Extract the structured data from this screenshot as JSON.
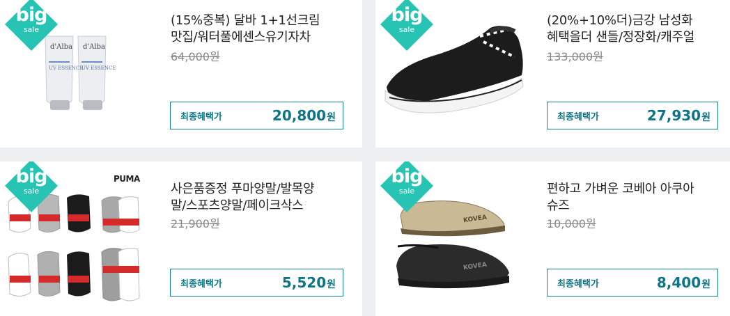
{
  "products": [
    {
      "badge": {
        "big": "big",
        "sale": "sale"
      },
      "title_line1": "(15%중복) 달바 1+1선크림",
      "title_line2": "맛집/워터풀에센스유기자차",
      "original_price": "64,000원",
      "final_label": "최종혜택가",
      "final_price": "20,800",
      "won": "원",
      "image_text": [
        "d'Alba",
        "d'Alba"
      ]
    },
    {
      "badge": {
        "big": "big",
        "sale": "sale"
      },
      "title_line1": "(20%+10%더)금강 남성화",
      "title_line2": "혜택을더 샌들/정장화/캐주얼",
      "original_price": "133,000원",
      "final_label": "최종혜택가",
      "final_price": "27,930",
      "won": "원"
    },
    {
      "badge": {
        "big": "big",
        "sale": "sale"
      },
      "title_line1": "사은품증정 푸마양말/발목양",
      "title_line2": "말/스포츠양말/페이크삭스",
      "original_price": "21,900원",
      "final_label": "최종혜택가",
      "final_price": "5,520",
      "won": "원",
      "image_text": [
        "PUMA"
      ]
    },
    {
      "badge": {
        "big": "big",
        "sale": "sale"
      },
      "title_line1": "편하고 가벼운 코베아 아쿠아",
      "title_line2": "슈즈",
      "original_price": "10,000원",
      "final_label": "최종혜택가",
      "final_price": "8,400",
      "won": "원",
      "image_text": [
        "KOVEA",
        "KOVEA"
      ]
    }
  ],
  "colors": {
    "badge": "#27c4b4",
    "accent": "#0d7585",
    "background": "#eeeff1"
  }
}
